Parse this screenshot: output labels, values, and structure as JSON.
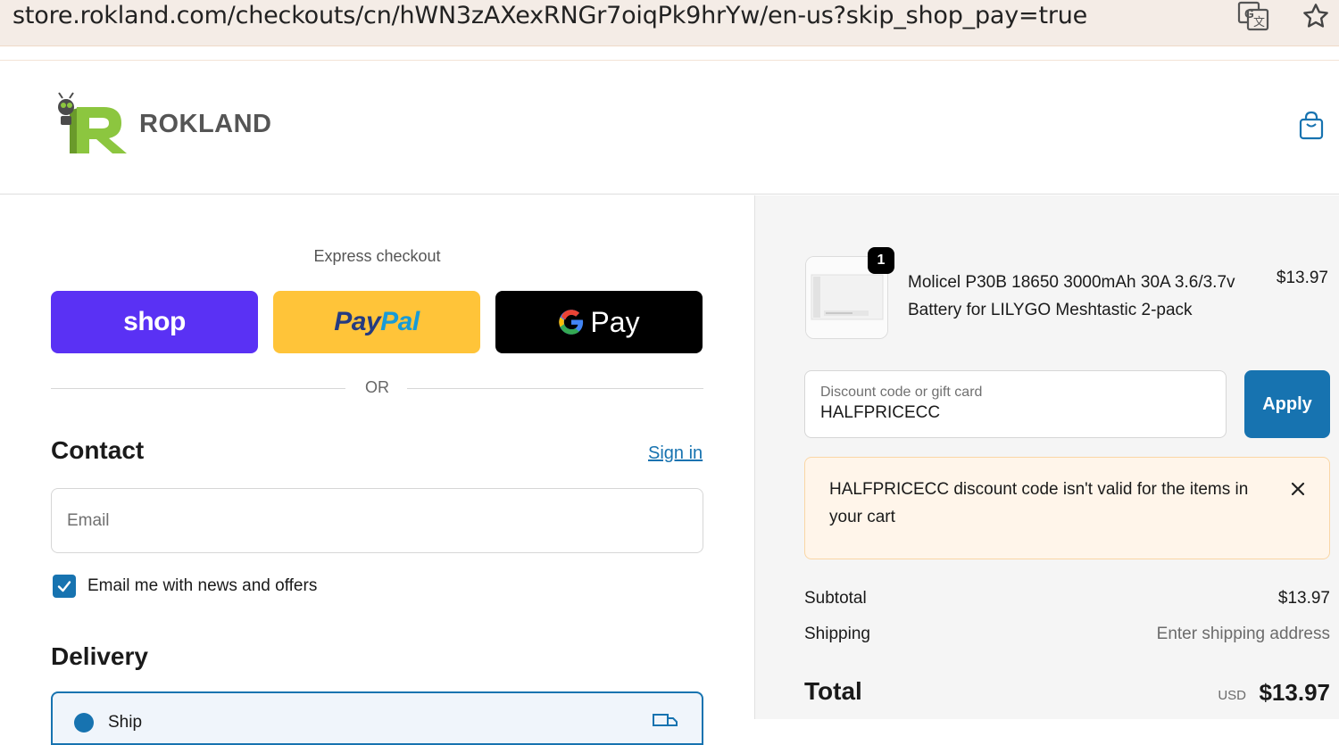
{
  "browser": {
    "url": "store.rokland.com/checkouts/cn/hWN3zAXexRNGr7oiqPk9hrYw/en-us?skip_shop_pay=true"
  },
  "store": {
    "logo_text": "ROKLAND",
    "brand_color": "#8cc63f"
  },
  "express": {
    "label": "Express checkout",
    "shop_label": "shop",
    "paypal_label": "PayPal",
    "gpay_label": "Pay",
    "or_label": "OR"
  },
  "contact": {
    "heading": "Contact",
    "signin_label": "Sign in",
    "email_placeholder": "Email",
    "news_label": "Email me with news and offers",
    "news_checked": true
  },
  "delivery": {
    "heading": "Delivery",
    "selected_option": "Ship"
  },
  "cart": {
    "items": [
      {
        "quantity": "1",
        "name": "Molicel P30B 18650 3000mAh 30A 3.6/3.7v Battery for LILYGO Meshtastic 2-pack",
        "price": "$13.97"
      }
    ],
    "discount": {
      "label": "Discount code or gift card",
      "value": "HALFPRICECC",
      "apply_label": "Apply"
    },
    "alert": {
      "message": "HALFPRICECC discount code isn't valid for the items in your cart"
    },
    "subtotal_label": "Subtotal",
    "subtotal_value": "$13.97",
    "shipping_label": "Shipping",
    "shipping_value": "Enter shipping address",
    "total_label": "Total",
    "currency": "USD",
    "total_value": "$13.97"
  },
  "colors": {
    "accent": "#1773b0",
    "shop_purple": "#5a31f4",
    "paypal_yellow": "#ffc439",
    "alert_bg": "#fff5ea"
  }
}
